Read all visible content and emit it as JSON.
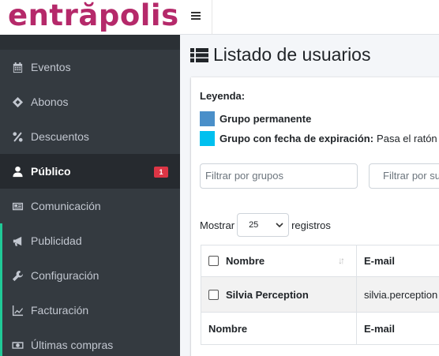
{
  "brand": {
    "logo_text": "entrăpolis!"
  },
  "sidebar": {
    "items": [
      {
        "label": "Eventos",
        "icon": "calendar-icon"
      },
      {
        "label": "Abonos",
        "icon": "ticket-icon"
      },
      {
        "label": "Descuentos",
        "icon": "percent-icon"
      },
      {
        "label": "Público",
        "icon": "user-icon",
        "active": true,
        "badge": "1"
      },
      {
        "label": "Comunicación",
        "icon": "newspaper-icon"
      },
      {
        "label": "Publicidad",
        "icon": "bullhorn-icon"
      },
      {
        "label": "Configuración",
        "icon": "wrench-icon"
      },
      {
        "label": "Facturación",
        "icon": "chart-line-icon"
      },
      {
        "label": "Últimas compras",
        "icon": "money-bill-icon"
      }
    ]
  },
  "page": {
    "title": "Listado de usuarios"
  },
  "legend": {
    "title": "Leyenda:",
    "items": [
      {
        "label": "Grupo permanente",
        "color": "#4a8fc9",
        "note": ""
      },
      {
        "label": "Grupo con fecha de expiración:",
        "color": "#00c0ef",
        "note": "Pasa el ratón por"
      }
    ]
  },
  "filters": {
    "groups_placeholder": "Filtrar por grupos",
    "other_placeholder": "Filtrar por su"
  },
  "pagination": {
    "show_label": "Mostrar",
    "page_size": "25",
    "records_label": "registros"
  },
  "table": {
    "headers": [
      "Nombre",
      "E-mail"
    ],
    "rows": [
      {
        "name": "Silvia Perception",
        "email": "silvia.perception"
      }
    ],
    "footer": [
      "Nombre",
      "E-mail"
    ]
  },
  "colors": {
    "accent": "#b5296a",
    "sidebar_bg": "#343a40",
    "badge": "#dc3545",
    "indicator": "#20c997"
  }
}
